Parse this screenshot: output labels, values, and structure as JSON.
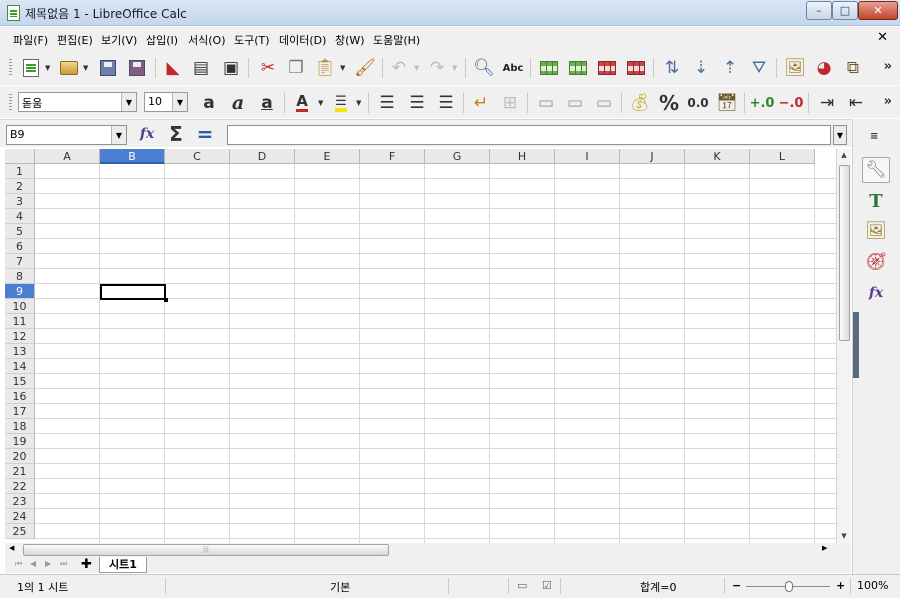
{
  "window": {
    "title": "제목없음 1 - LibreOffice Calc",
    "min": "–",
    "max": "□",
    "close": "✕"
  },
  "menu": {
    "items": [
      "파일(F)",
      "편집(E)",
      "보기(V)",
      "삽입(I)",
      "서식(O)",
      "도구(T)",
      "데이터(D)",
      "창(W)",
      "도움말(H)"
    ],
    "doc_close": "✕"
  },
  "toolbar_standard": {
    "more": "»",
    "spellcheck_label": "Abc"
  },
  "toolbar_format": {
    "font_name": "돋움",
    "font_size": "10",
    "number_format_label": "0.0",
    "percent_label": "%",
    "more": "»"
  },
  "formula_bar": {
    "name_box": "B9",
    "formula": "",
    "sum_symbol": "Σ",
    "equals_symbol": "="
  },
  "sheet": {
    "columns": [
      "A",
      "B",
      "C",
      "D",
      "E",
      "F",
      "G",
      "H",
      "I",
      "J",
      "K",
      "L"
    ],
    "rows": [
      "1",
      "2",
      "3",
      "4",
      "5",
      "6",
      "7",
      "8",
      "9",
      "10",
      "11",
      "12",
      "13",
      "14",
      "15",
      "16",
      "17",
      "18",
      "19",
      "20",
      "21",
      "22",
      "23",
      "24",
      "25"
    ],
    "selected_column": "B",
    "selected_row": "9",
    "selected_cell": "B9"
  },
  "tabs": {
    "add": "✚",
    "items": [
      "시트1"
    ]
  },
  "status": {
    "sheet_position": "1의 1 시트",
    "page_style": "기본",
    "sum": "합계=0",
    "zoom_minus": "−",
    "zoom_plus": "+",
    "zoom_level": "100%"
  },
  "colors": {
    "accent": "#4a7fd1",
    "selection_border": "#000000"
  }
}
